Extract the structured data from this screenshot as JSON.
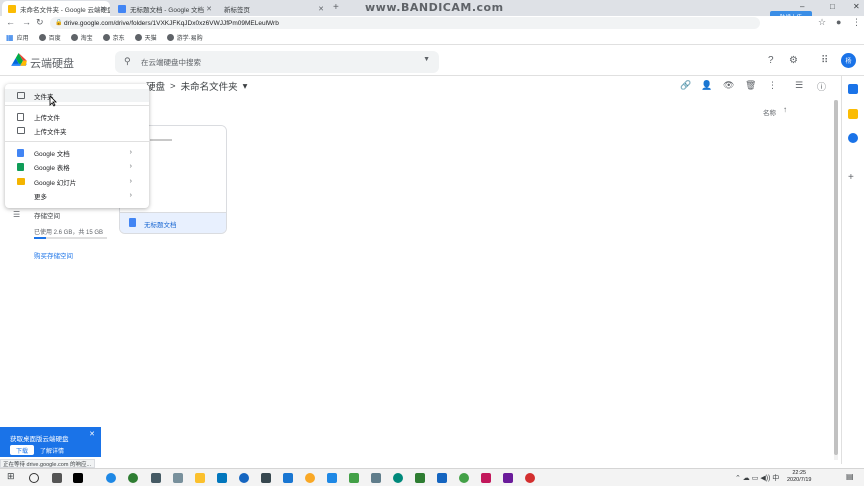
{
  "browser": {
    "tabs": [
      {
        "title": "未命名文件夹 - Google 云端硬盘",
        "active": true
      },
      {
        "title": "无标题文档 - Google 文档",
        "active": false
      },
      {
        "title": "新标签页",
        "active": false
      }
    ],
    "url": "drive.google.com/drive/folders/1VXKJFKqJDx0xz6VWJJfPm09MELeulWrb",
    "watermark": "www.BANDICAM.com",
    "bandicam_button": "陆续上传",
    "bookmarks": [
      "应用",
      "百度",
      "淘宝",
      "京东",
      "天猫",
      "游学·易购"
    ]
  },
  "drive": {
    "brand": "云端硬盘",
    "search_placeholder": "在云端硬盘中搜索",
    "avatar_initial": "杨",
    "breadcrumb": {
      "parent": "硬盘",
      "separator": ">",
      "current": "未命名文件夹",
      "dropdown": "▾"
    },
    "sort": {
      "label": "名称",
      "arrow": "↑"
    },
    "file_card": {
      "name": "无标题文档"
    },
    "storage": {
      "label": "存储空间",
      "used_text": "已使用 2.6 GB，共 15 GB",
      "used_fraction": 0.17,
      "buy_label": "购买存储空间"
    }
  },
  "new_menu": {
    "items": [
      {
        "label": "文件夹",
        "icon": "new-folder-icon",
        "hover": true
      },
      {
        "label": "上传文件",
        "icon": "file-upload-icon"
      },
      {
        "label": "上传文件夹",
        "icon": "folder-upload-icon"
      },
      {
        "label": "Google 文档",
        "icon": "google-docs-icon",
        "submenu": true,
        "color": "#4285f4"
      },
      {
        "label": "Google 表格",
        "icon": "google-sheets-icon",
        "submenu": true,
        "color": "#0f9d58"
      },
      {
        "label": "Google 幻灯片",
        "icon": "google-slides-icon",
        "submenu": true,
        "color": "#f4b400"
      },
      {
        "label": "更多",
        "icon": "",
        "submenu": true
      }
    ],
    "chevron": "›"
  },
  "toast": {
    "title": "获取桌面版云端硬盘",
    "download_label": "下载",
    "more_label": "了解详情",
    "close": "✕"
  },
  "status_bar": "正在等待 drive.google.com 的响应...",
  "taskbar": {
    "time": "22:25",
    "date": "2020/7/19"
  },
  "colors": {
    "accent": "#1a73e8",
    "selected_file": "#e8f0fe",
    "toast": "#1a73e8"
  }
}
